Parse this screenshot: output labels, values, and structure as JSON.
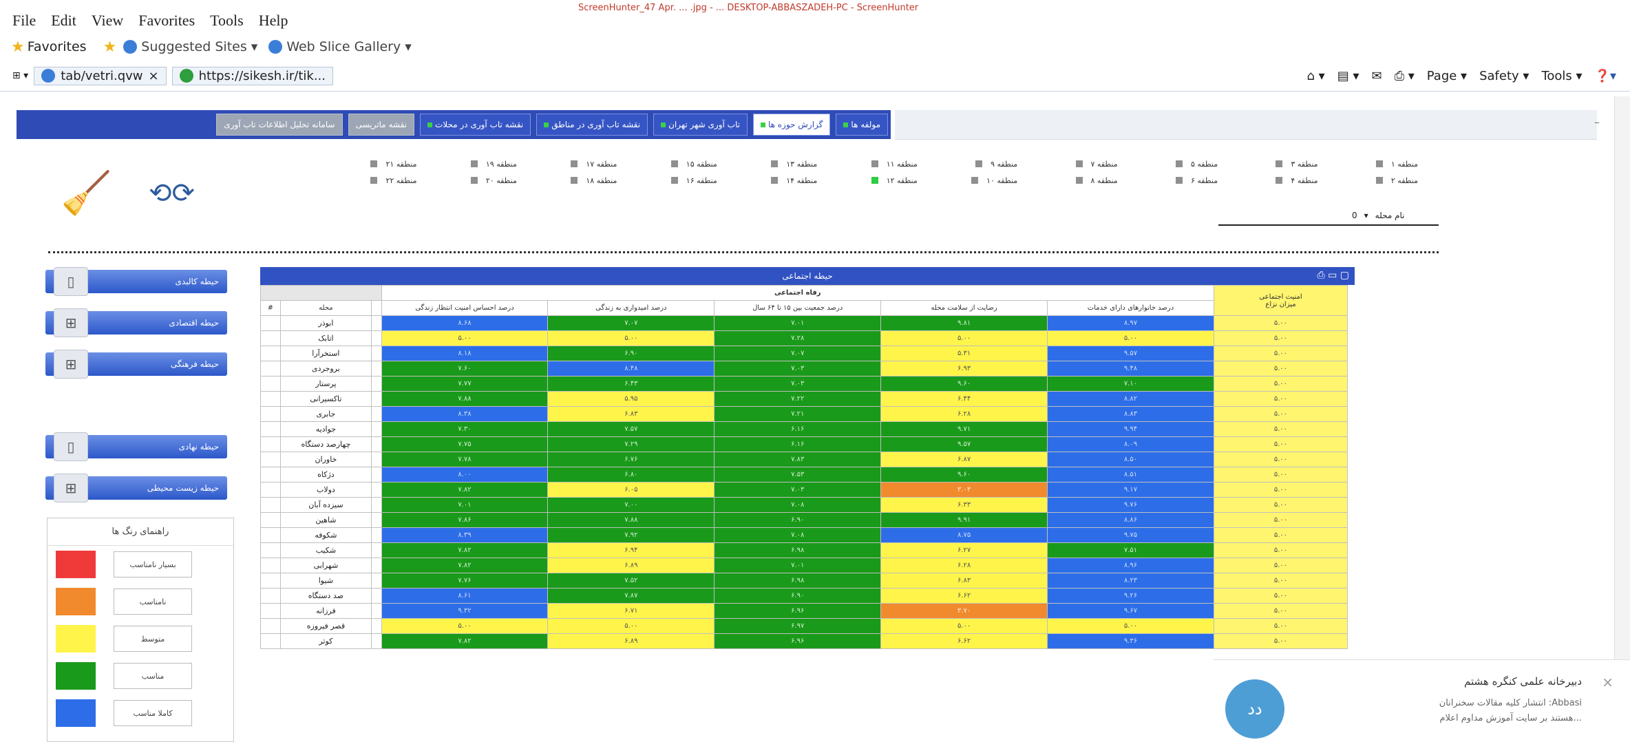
{
  "browser": {
    "capture_note": "ScreenHunter_47 Apr. ... .jpg - ... DESKTOP-ABBASZADEH-PC - ScreenHunter",
    "menu": [
      "File",
      "Edit",
      "View",
      "Favorites",
      "Tools",
      "Help"
    ],
    "favorites_label": "Favorites",
    "fav_items": [
      "Suggested Sites ▾",
      "Web Slice Gallery ▾"
    ],
    "tab_title": "tab/vetri.qvw",
    "tab_url": "https://sikesh.ir/tik...",
    "commands": [
      "Page ▾",
      "Safety ▾",
      "Tools ▾"
    ]
  },
  "nav": {
    "tabs": [
      {
        "label": "مولفه ها",
        "state": "normal",
        "dot": true
      },
      {
        "label": "گزارش حوزه ها",
        "state": "active",
        "dot": true
      },
      {
        "label": "تاب آوری شهر تهران",
        "state": "normal",
        "dot": true
      },
      {
        "label": "نقشه تاب آوری در مناطق",
        "state": "normal",
        "dot": true
      },
      {
        "label": "نقشه تاب آوری در محلات",
        "state": "normal",
        "dot": true
      },
      {
        "label": "نقشه ماتریسی",
        "state": "dull",
        "dot": false
      },
      {
        "label": "سامانه تحلیل اطلاعات تاب آوری",
        "state": "dull",
        "dot": false
      }
    ]
  },
  "regions": {
    "row1": [
      {
        "label": "منطقه ۱",
        "checked": false
      },
      {
        "label": "منطقه ۳",
        "checked": false
      },
      {
        "label": "منطقه ۵",
        "checked": false
      },
      {
        "label": "منطقه ۷",
        "checked": false
      },
      {
        "label": "منطقه ۹",
        "checked": false
      },
      {
        "label": "منطقه ۱۱",
        "checked": false
      },
      {
        "label": "منطقه ۱۳",
        "checked": false
      },
      {
        "label": "منطقه ۱۵",
        "checked": false
      },
      {
        "label": "منطقه ۱۷",
        "checked": false
      },
      {
        "label": "منطقه ۱۹",
        "checked": false
      },
      {
        "label": "منطقه ۲۱",
        "checked": false
      }
    ],
    "row2": [
      {
        "label": "منطقه ۲",
        "checked": false
      },
      {
        "label": "منطقه ۴",
        "checked": false
      },
      {
        "label": "منطقه ۶",
        "checked": false
      },
      {
        "label": "منطقه ۸",
        "checked": false
      },
      {
        "label": "منطقه ۱۰",
        "checked": false
      },
      {
        "label": "منطقه ۱۲",
        "checked": true
      },
      {
        "label": "منطقه ۱۴",
        "checked": false
      },
      {
        "label": "منطقه ۱۶",
        "checked": false
      },
      {
        "label": "منطقه ۱۸",
        "checked": false
      },
      {
        "label": "منطقه ۲۰",
        "checked": false
      },
      {
        "label": "منطقه ۲۲",
        "checked": false
      }
    ],
    "select_label": "نام محله",
    "select_value": "0"
  },
  "side_buttons": [
    {
      "label": "حیطه کالبدی",
      "icon": "building-icon",
      "glyph": "▯"
    },
    {
      "label": "حیطه اقتصادی",
      "icon": "grid-icon",
      "glyph": "⊞"
    },
    {
      "label": "حیطه فرهنگی",
      "icon": "grid-icon",
      "glyph": "⊞"
    },
    {
      "label": "حیطه نهادی",
      "icon": "building-icon",
      "glyph": "▯"
    },
    {
      "label": "حیطه زیست محیطی",
      "icon": "grid-icon",
      "glyph": "⊞"
    }
  ],
  "legend": {
    "title": "راهنمای رنگ ها",
    "items": [
      {
        "label": "بسیار نامناسب",
        "color": "#f03a3a"
      },
      {
        "label": "نامناسب",
        "color": "#f18a2d"
      },
      {
        "label": "متوسط",
        "color": "#fff44a"
      },
      {
        "label": "مناسب",
        "color": "#1a9a1a"
      },
      {
        "label": "کاملا مناسب",
        "color": "#2d6ee8"
      }
    ]
  },
  "table": {
    "panel_title": "حیطه اجتماعی",
    "group_header": "رفاه اجتماعی",
    "corner_header": "امنیت اجتماعی",
    "col_index": "#",
    "col_name": "محله",
    "columns": [
      "درصد احساس امنیت انتظار زندگی",
      "درصد امیدواری به زندگی",
      "درصد جمعیت بین ۱۵ تا ۶۴ سال",
      "رضایت از سلامت محله",
      "درصد خانوارهای دارای خدمات",
      "میزان نزاع"
    ],
    "rows": [
      {
        "name": "ابوذر",
        "cells": [
          [
            "B",
            "۸.۶۸"
          ],
          [
            "G",
            "۷.۰۷"
          ],
          [
            "G",
            "۷.۰۱"
          ],
          [
            "G",
            "۹.۸۱"
          ],
          [
            "B",
            "۸.۹۷"
          ],
          [
            "Y",
            "۵.۰۰"
          ]
        ]
      },
      {
        "name": "اتابک",
        "cells": [
          [
            "Y",
            "۵.۰۰"
          ],
          [
            "Y",
            "۵.۰۰"
          ],
          [
            "G",
            "۷.۲۸"
          ],
          [
            "Y",
            "۵.۰۰"
          ],
          [
            "Y",
            "۵.۰۰"
          ],
          [
            "Y",
            "۵.۰۰"
          ]
        ]
      },
      {
        "name": "استخرآرا",
        "cells": [
          [
            "B",
            "۸.۱۸"
          ],
          [
            "G",
            "۶.۹۰"
          ],
          [
            "G",
            "۷.۰۷"
          ],
          [
            "Y",
            "۵.۳۱"
          ],
          [
            "B",
            "۹.۵۷"
          ],
          [
            "Y",
            "۵.۰۰"
          ]
        ]
      },
      {
        "name": "بروجردی",
        "cells": [
          [
            "G",
            "۷.۶۰"
          ],
          [
            "B",
            "۸.۴۸"
          ],
          [
            "G",
            "۷.۰۳"
          ],
          [
            "Y",
            "۶.۹۳"
          ],
          [
            "B",
            "۹.۴۸"
          ],
          [
            "Y",
            "۵.۰۰"
          ]
        ]
      },
      {
        "name": "پرستار",
        "cells": [
          [
            "G",
            "۷.۷۷"
          ],
          [
            "G",
            "۶.۴۳"
          ],
          [
            "G",
            "۷.۰۳"
          ],
          [
            "G",
            "۹.۶۰"
          ],
          [
            "G",
            "۷.۱۰"
          ],
          [
            "Y",
            "۵.۰۰"
          ]
        ]
      },
      {
        "name": "تاکسیرانی",
        "cells": [
          [
            "G",
            "۷.۸۸"
          ],
          [
            "Y",
            "۵.۹۵"
          ],
          [
            "G",
            "۷.۲۲"
          ],
          [
            "Y",
            "۶.۴۴"
          ],
          [
            "B",
            "۸.۸۲"
          ],
          [
            "Y",
            "۵.۰۰"
          ]
        ]
      },
      {
        "name": "جابری",
        "cells": [
          [
            "B",
            "۸.۳۸"
          ],
          [
            "Y",
            "۶.۸۳"
          ],
          [
            "G",
            "۷.۲۱"
          ],
          [
            "Y",
            "۶.۲۸"
          ],
          [
            "B",
            "۸.۸۳"
          ],
          [
            "Y",
            "۵.۰۰"
          ]
        ]
      },
      {
        "name": "جوادیه",
        "cells": [
          [
            "G",
            "۷.۳۰"
          ],
          [
            "G",
            "۷.۵۷"
          ],
          [
            "G",
            "۶.۱۶"
          ],
          [
            "G",
            "۹.۷۱"
          ],
          [
            "B",
            "۹.۹۴"
          ],
          [
            "Y",
            "۵.۰۰"
          ]
        ]
      },
      {
        "name": "چهارصد دستگاه",
        "cells": [
          [
            "G",
            "۷.۷۵"
          ],
          [
            "G",
            "۷.۲۹"
          ],
          [
            "G",
            "۶.۱۶"
          ],
          [
            "G",
            "۹.۵۷"
          ],
          [
            "B",
            "۸.۰۹"
          ],
          [
            "Y",
            "۵.۰۰"
          ]
        ]
      },
      {
        "name": "خاوران",
        "cells": [
          [
            "G",
            "۷.۷۸"
          ],
          [
            "G",
            "۶.۷۶"
          ],
          [
            "G",
            "۷.۸۳"
          ],
          [
            "Y",
            "۶.۸۷"
          ],
          [
            "B",
            "۸.۵۰"
          ],
          [
            "Y",
            "۵.۰۰"
          ]
        ]
      },
      {
        "name": "دژکاه",
        "cells": [
          [
            "B",
            "۸.۰۰"
          ],
          [
            "G",
            "۶.۸۰"
          ],
          [
            "G",
            "۷.۵۳"
          ],
          [
            "G",
            "۹.۶۰"
          ],
          [
            "B",
            "۸.۵۱"
          ],
          [
            "Y",
            "۵.۰۰"
          ]
        ]
      },
      {
        "name": "دولاب",
        "cells": [
          [
            "G",
            "۷.۸۲"
          ],
          [
            "Y",
            "۶.۰۵"
          ],
          [
            "G",
            "۷.۰۳"
          ],
          [
            "O",
            "۳.۰۳"
          ],
          [
            "B",
            "۹.۱۷"
          ],
          [
            "Y",
            "۵.۰۰"
          ]
        ]
      },
      {
        "name": "سیزده آبان",
        "cells": [
          [
            "G",
            "۷.۰۱"
          ],
          [
            "G",
            "۷.۰۰"
          ],
          [
            "G",
            "۷.۰۸"
          ],
          [
            "Y",
            "۶.۳۳"
          ],
          [
            "B",
            "۹.۷۶"
          ],
          [
            "Y",
            "۵.۰۰"
          ]
        ]
      },
      {
        "name": "شاهین",
        "cells": [
          [
            "G",
            "۷.۸۶"
          ],
          [
            "G",
            "۷.۸۸"
          ],
          [
            "G",
            "۶.۹۰"
          ],
          [
            "G",
            "۹.۹۱"
          ],
          [
            "B",
            "۸.۸۶"
          ],
          [
            "Y",
            "۵.۰۰"
          ]
        ]
      },
      {
        "name": "شکوفه",
        "cells": [
          [
            "B",
            "۸.۳۹"
          ],
          [
            "G",
            "۷.۹۲"
          ],
          [
            "G",
            "۷.۰۸"
          ],
          [
            "B",
            "۸.۷۵"
          ],
          [
            "B",
            "۹.۷۵"
          ],
          [
            "Y",
            "۵.۰۰"
          ]
        ]
      },
      {
        "name": "شکیب",
        "cells": [
          [
            "G",
            "۷.۸۲"
          ],
          [
            "Y",
            "۶.۹۴"
          ],
          [
            "G",
            "۶.۹۸"
          ],
          [
            "Y",
            "۶.۲۷"
          ],
          [
            "G",
            "۷.۵۱"
          ],
          [
            "Y",
            "۵.۰۰"
          ]
        ]
      },
      {
        "name": "شهرابی",
        "cells": [
          [
            "G",
            "۷.۸۲"
          ],
          [
            "Y",
            "۶.۸۹"
          ],
          [
            "G",
            "۷.۰۱"
          ],
          [
            "Y",
            "۶.۲۸"
          ],
          [
            "B",
            "۸.۹۶"
          ],
          [
            "Y",
            "۵.۰۰"
          ]
        ]
      },
      {
        "name": "شیوا",
        "cells": [
          [
            "G",
            "۷.۷۶"
          ],
          [
            "G",
            "۷.۵۲"
          ],
          [
            "G",
            "۶.۹۸"
          ],
          [
            "Y",
            "۶.۸۳"
          ],
          [
            "B",
            "۸.۲۳"
          ],
          [
            "Y",
            "۵.۰۰"
          ]
        ]
      },
      {
        "name": "صد دستگاه",
        "cells": [
          [
            "B",
            "۸.۶۱"
          ],
          [
            "G",
            "۷.۸۷"
          ],
          [
            "G",
            "۶.۹۰"
          ],
          [
            "Y",
            "۶.۶۲"
          ],
          [
            "B",
            "۹.۲۶"
          ],
          [
            "Y",
            "۵.۰۰"
          ]
        ]
      },
      {
        "name": "فرزانه",
        "cells": [
          [
            "B",
            "۹.۳۲"
          ],
          [
            "Y",
            "۶.۷۱"
          ],
          [
            "G",
            "۶.۹۶"
          ],
          [
            "O",
            "۳.۷۰"
          ],
          [
            "B",
            "۹.۶۷"
          ],
          [
            "Y",
            "۵.۰۰"
          ]
        ]
      },
      {
        "name": "قصر فیروزه",
        "cells": [
          [
            "Y",
            "۵.۰۰"
          ],
          [
            "Y",
            "۵.۰۰"
          ],
          [
            "G",
            "۶.۹۷"
          ],
          [
            "Y",
            "۵.۰۰"
          ],
          [
            "Y",
            "۵.۰۰"
          ],
          [
            "Y",
            "۵.۰۰"
          ]
        ]
      },
      {
        "name": "کوثر",
        "cells": [
          [
            "G",
            "۷.۸۲"
          ],
          [
            "Y",
            "۶.۸۹"
          ],
          [
            "G",
            "۶.۹۶"
          ],
          [
            "Y",
            "۶.۶۲"
          ],
          [
            "B",
            "۹.۳۶"
          ],
          [
            "Y",
            "۵.۰۰"
          ]
        ]
      }
    ]
  },
  "notification": {
    "title": "دبیرخانه علمی کنگره هشتم",
    "body_line1": "Abbasi: انتشار کلیه مقالات سخنرانان",
    "body_line2": "...هستند بر سایت آموزش مداوم اعلام",
    "avatar_text": "دد",
    "close_glyph": "×"
  }
}
